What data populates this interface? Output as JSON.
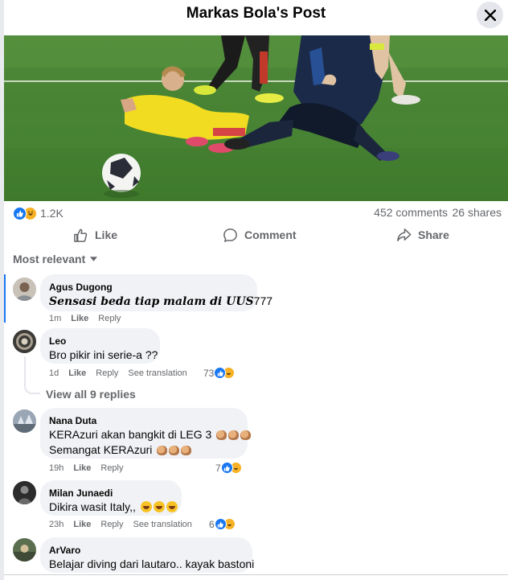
{
  "post": {
    "title": "Markas Bola's Post",
    "reaction_count": "1.2K",
    "comments_count": "452 comments",
    "shares_count": "26 shares"
  },
  "actions": {
    "like": "Like",
    "comment": "Comment",
    "share": "Share"
  },
  "sort_label": "Most relevant",
  "comments": [
    {
      "author": "Agus Dugong",
      "text_styled": "Sensasi beda tiap malam di UUS",
      "text_num": "777",
      "time": "1m",
      "like": "Like",
      "reply": "Reply"
    },
    {
      "author": "Leo",
      "text": "Bro pikir ini serie-a ??",
      "time": "1d",
      "like": "Like",
      "reply": "Reply",
      "translate": "See translation",
      "reaction_count": "73",
      "view_replies": "View all 9 replies"
    },
    {
      "author": "Nana Duta",
      "text_line1": "KERAzuri akan bangkit di LEG 3",
      "text_line2": "Semangat KERAzuri",
      "time": "19h",
      "like": "Like",
      "reply": "Reply",
      "reaction_count": "7"
    },
    {
      "author": "Milan Junaedi",
      "text": "Dikira wasit Italy,,",
      "time": "23h",
      "like": "Like",
      "reply": "Reply",
      "translate": "See translation",
      "reaction_count": "6"
    },
    {
      "author": "ArVaro",
      "text": "Belajar diving dari lautaro.. kayak bastoni"
    }
  ],
  "icons": {
    "close": "close-icon",
    "like": "thumbs-up-icon",
    "comment": "speech-bubble-icon",
    "share": "share-arrow-icon",
    "sort": "caret-down-icon"
  },
  "colors": {
    "brand_blue": "#1877f2",
    "haha_yellow": "#f7b125",
    "bubble_gray": "#f0f2f5",
    "secondary_text": "#65676b"
  }
}
